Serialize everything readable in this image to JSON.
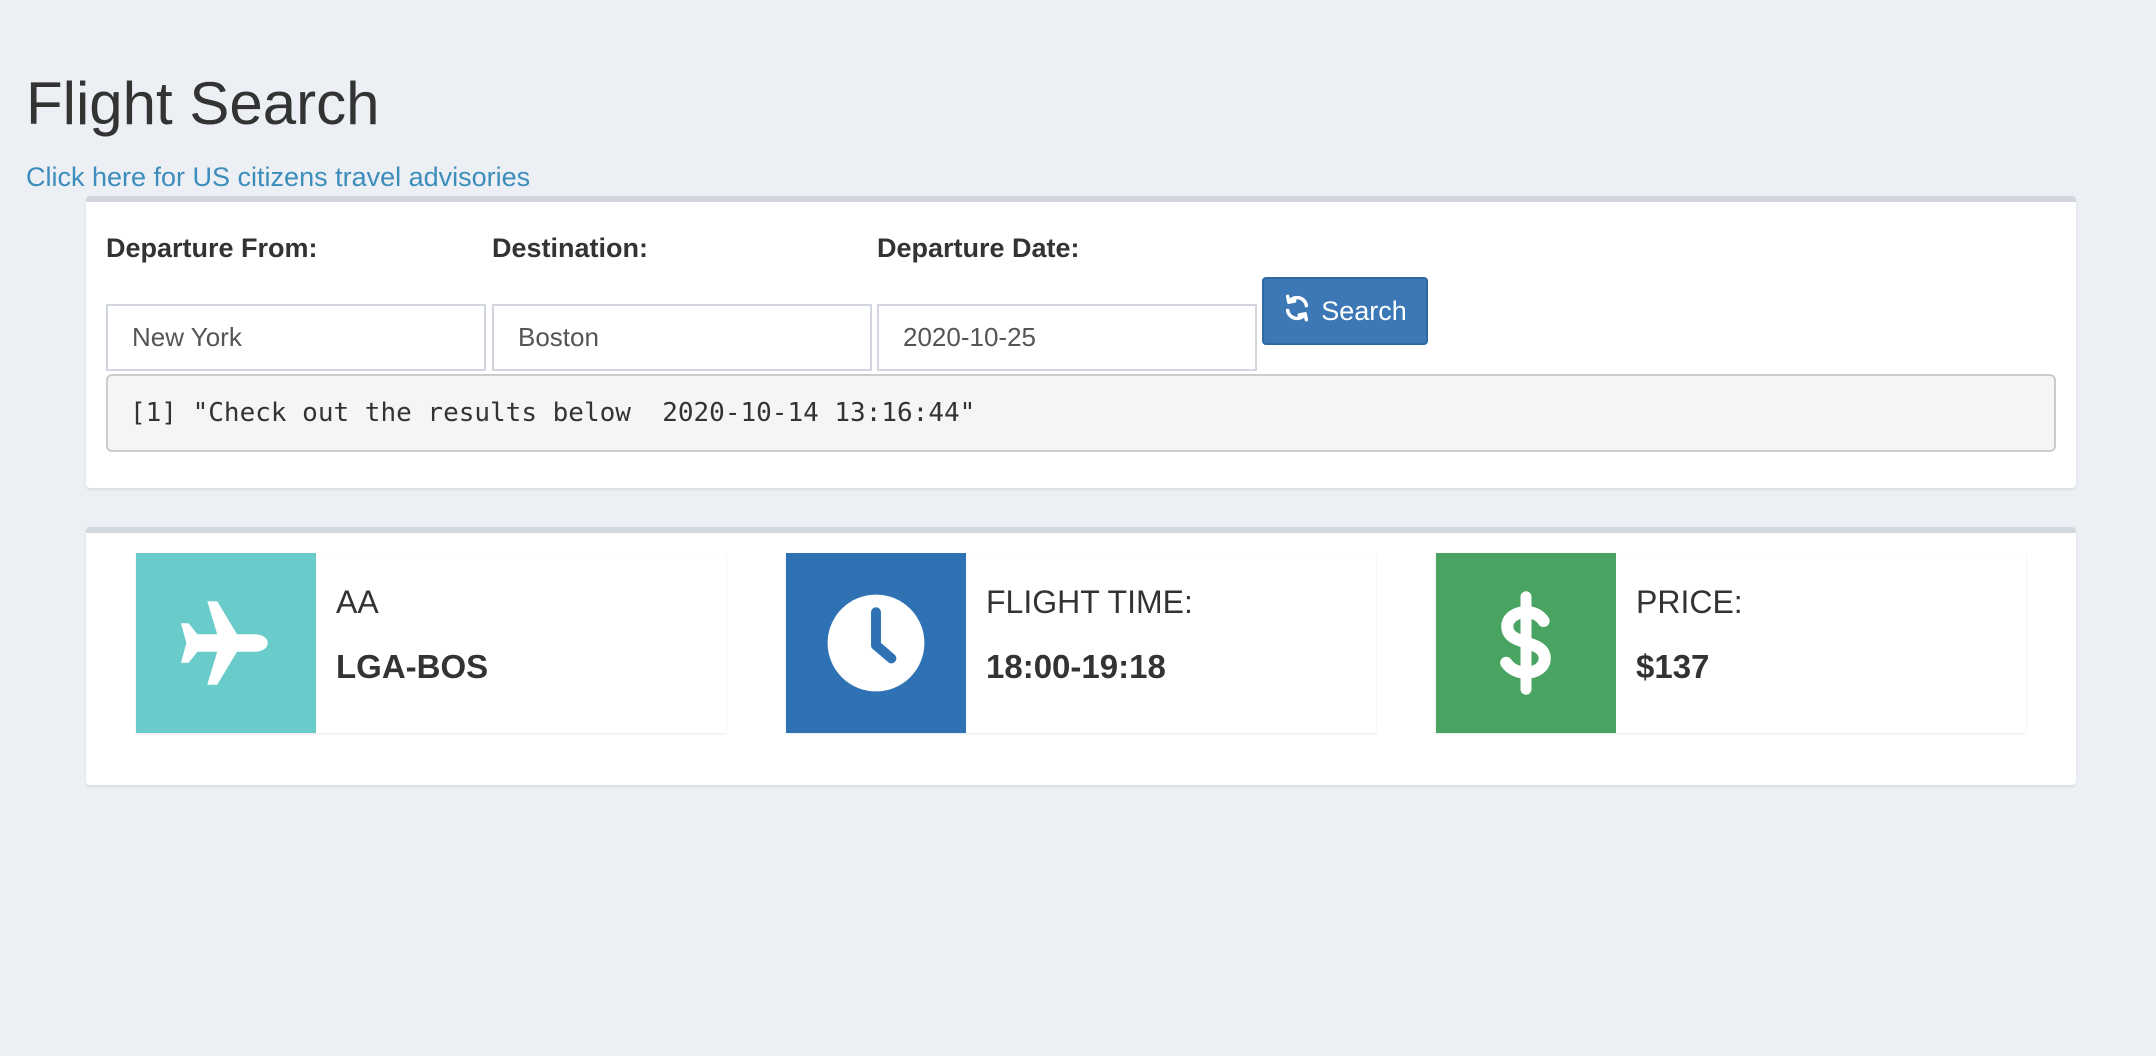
{
  "page": {
    "title": "Flight Search",
    "advisory_link": "Click here for US citizens travel advisories"
  },
  "search_form": {
    "departure_label": "Departure From:",
    "departure_value": "New York",
    "destination_label": "Destination:",
    "destination_value": "Boston",
    "date_label": "Departure Date:",
    "date_value": "2020-10-25",
    "search_button_label": "Search",
    "search_button_icon": "refresh-icon"
  },
  "console": {
    "output": "[1] \"Check out the results below  2020-10-14 13:16:44\""
  },
  "results": {
    "airline": {
      "icon": "plane-icon",
      "color": "#69cbca",
      "text": "AA",
      "number": "LGA-BOS"
    },
    "flight_time": {
      "icon": "clock-icon",
      "color": "#2e72b4",
      "text": "FLIGHT TIME:",
      "number": "18:00-19:18"
    },
    "price": {
      "icon": "dollar-icon",
      "color": "#49a461",
      "text": "PRICE:",
      "number": "$137"
    }
  }
}
